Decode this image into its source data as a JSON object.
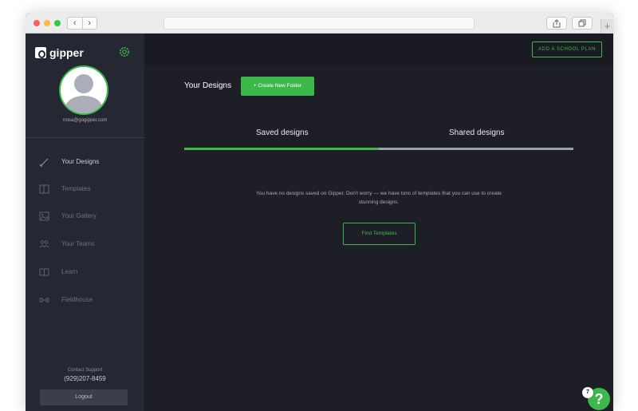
{
  "browser": {
    "nav_back": "‹",
    "nav_forward": "›",
    "new_tab": "+"
  },
  "sidebar": {
    "logo_text": "gipper",
    "email": "rrosa@gogipper.com",
    "items": [
      {
        "label": "Your Designs",
        "icon": "brush-icon",
        "active": true
      },
      {
        "label": "Templates",
        "icon": "template-icon",
        "active": false
      },
      {
        "label": "Your Gallery",
        "icon": "gallery-icon",
        "active": false
      },
      {
        "label": "Your Teams",
        "icon": "teams-icon",
        "active": false
      },
      {
        "label": "Learn",
        "icon": "book-icon",
        "active": false
      },
      {
        "label": "Fieldhouse",
        "icon": "fieldhouse-icon",
        "active": false
      }
    ],
    "support_label": "Contact Support",
    "support_phone": "(929)207-8459",
    "logout_label": "Logout"
  },
  "topbar": {
    "school_plan_label": "ADD A SCHOOL PLAN"
  },
  "main": {
    "title": "Your Designs",
    "create_folder_label": "+ Create New Folder",
    "tabs": [
      {
        "label": "Saved designs",
        "active": true
      },
      {
        "label": "Shared designs",
        "active": false
      }
    ],
    "empty_message": "You have no designs saved on Gipper. Don't worry — we have tons of templates that you can use to create stunning designs.",
    "find_templates_label": "Find Templates"
  },
  "help": {
    "label": "?",
    "badge_count": "7"
  },
  "colors": {
    "accent": "#3cb94a",
    "sidebar_bg": "#252832",
    "main_bg": "#1e1e26",
    "topbar_bg": "#1a1b22"
  }
}
